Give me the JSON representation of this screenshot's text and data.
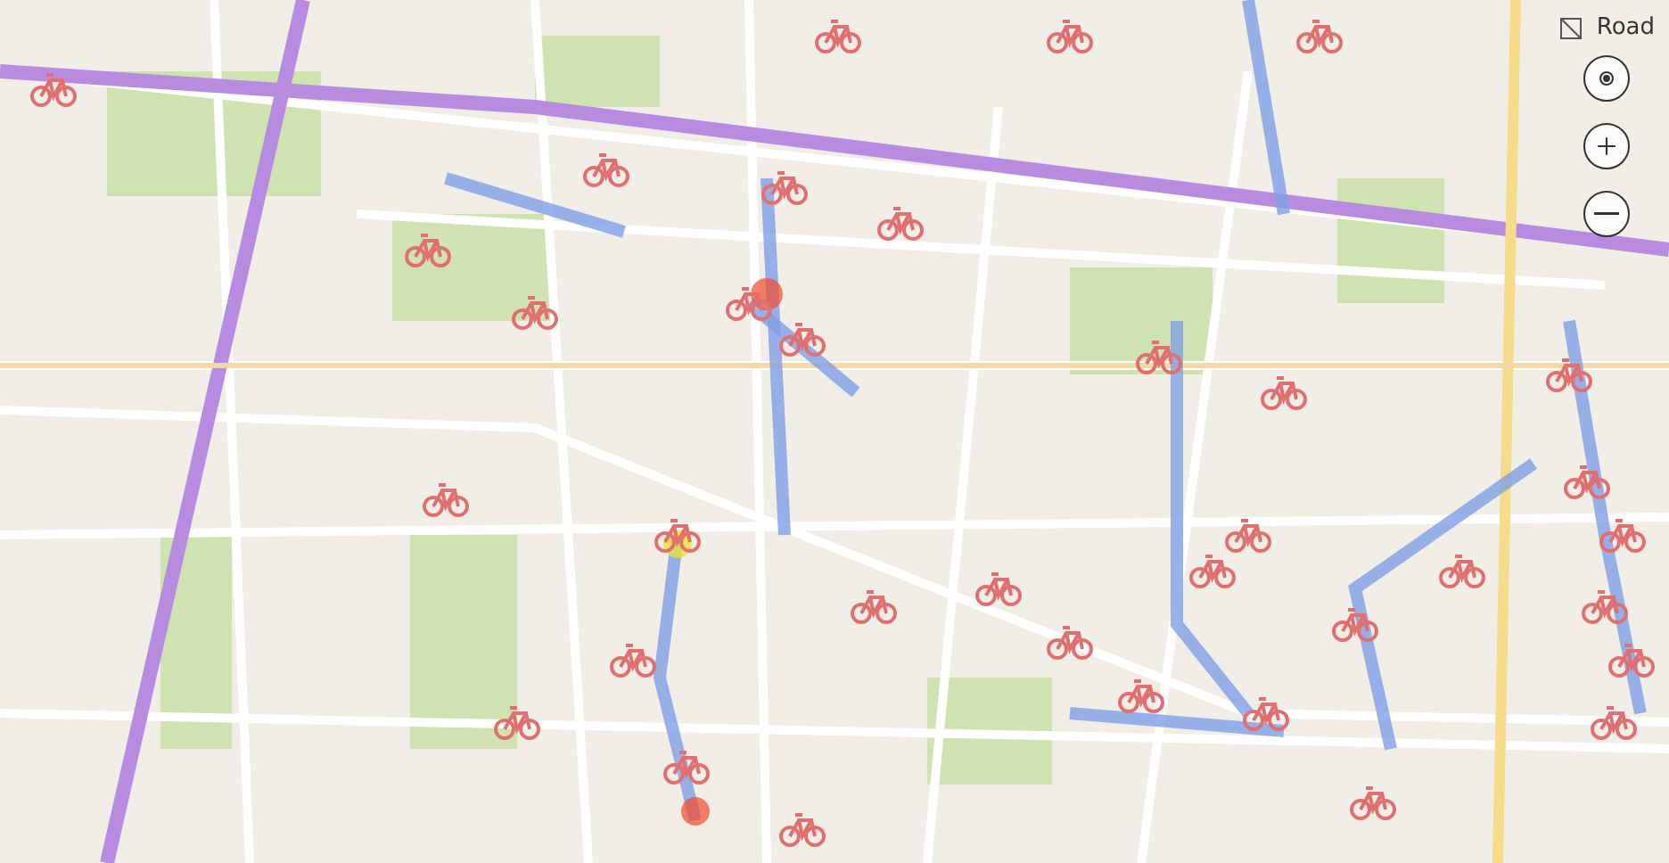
{
  "map": {
    "style_label": "Road"
  },
  "controls": [
    {
      "kind": "locate"
    },
    {
      "kind": "zoom_in"
    },
    {
      "kind": "zoom_out"
    }
  ]
}
